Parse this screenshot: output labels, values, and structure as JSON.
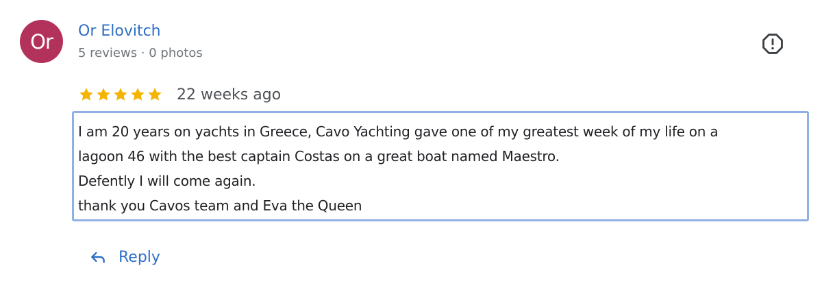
{
  "author": {
    "initials": "Or",
    "name": "Or Elovitch",
    "meta": "5 reviews · 0 photos",
    "avatar_color": "#b3325c"
  },
  "review": {
    "rating": 5,
    "max_rating": 5,
    "date": "22 weeks ago",
    "text": "I am 20 years on yachts in Greece, Cavo Yachting gave one of my greatest week of my life on a\nlagoon 46 with the best captain Costas on a great boat named Maestro.\nDefently I will come again.\nthank you Cavos team and Eva the Queen"
  },
  "actions": {
    "report_icon": "report-icon",
    "reply_icon": "reply-arrow-icon",
    "reply_label": "Reply"
  },
  "colors": {
    "link": "#2f6fc4",
    "star": "#f4b400",
    "highlight_border": "#8fb0e4"
  }
}
